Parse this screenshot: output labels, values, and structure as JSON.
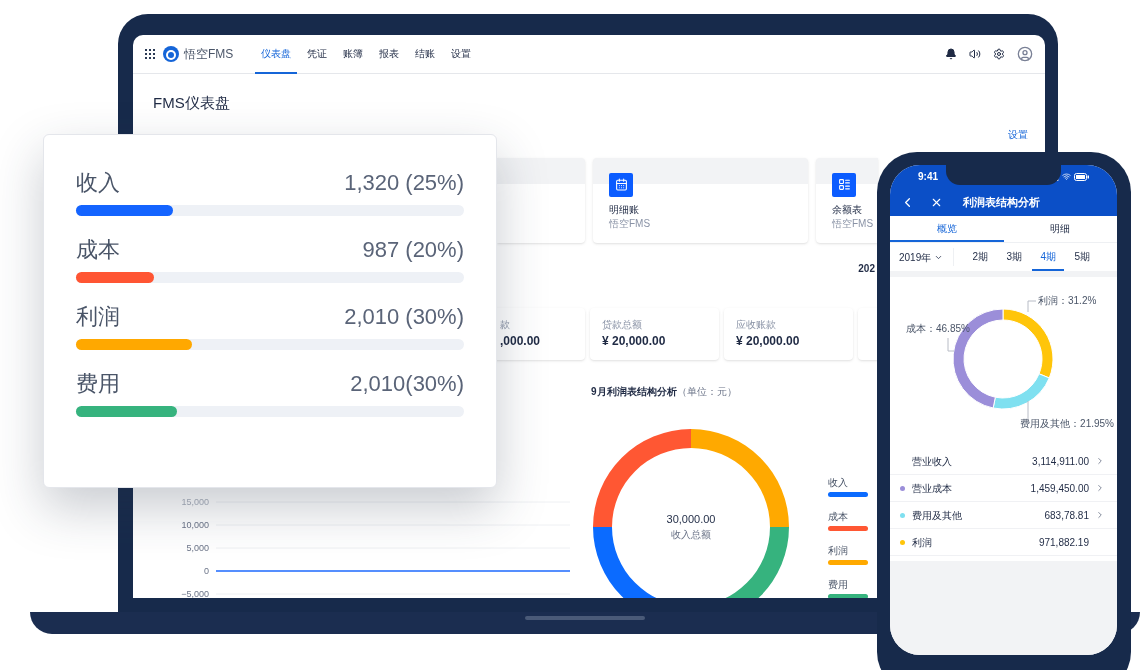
{
  "laptop": {
    "nav": {
      "brand": "悟空FMS",
      "tabs": [
        {
          "label": "仪表盘",
          "selected": true
        },
        {
          "label": "凭证",
          "selected": false
        },
        {
          "label": "账簿",
          "selected": false
        },
        {
          "label": "报表",
          "selected": false
        },
        {
          "label": "结账",
          "selected": false
        },
        {
          "label": "设置",
          "selected": false
        }
      ]
    },
    "page_title": "FMS仪表盘",
    "settings_link": "设置",
    "shortcuts": [
      {
        "title": "明细账",
        "subtitle": "悟空FMS",
        "kind": "calendar"
      },
      {
        "title": "余额表",
        "subtitle": "悟空FMS",
        "kind": "list"
      }
    ],
    "date_text": "202",
    "stats": [
      {
        "label": "款",
        "value": ",000.00"
      },
      {
        "label": "贷款总额",
        "value": "¥ 20,000.00"
      },
      {
        "label": "应收账款",
        "value": "¥ 20,000.00"
      }
    ],
    "line_chart": {
      "chart_data": {
        "type": "line",
        "ylim": [
          -5000,
          15000
        ],
        "yticks": [
          {
            "value": -5000,
            "label": "−5,000"
          },
          0,
          {
            "value": 5000,
            "label": "5,000"
          },
          {
            "value": 10000,
            "label": "10,000"
          },
          {
            "value": 15000,
            "label": "15,000"
          }
        ],
        "series": [
          {
            "color": "#1f6bff",
            "values": [
              0,
              0,
              0,
              0,
              0,
              0,
              0,
              0,
              0,
              0,
              0,
              0
            ]
          }
        ]
      }
    },
    "donut": {
      "title": "9月利润表结构分析",
      "unit": "（单位：元）",
      "total": "30,000.00",
      "total_label": "收入总额",
      "legend": [
        {
          "label": "收入",
          "color": "#0b6bff"
        },
        {
          "label": "成本",
          "color": "#ff5733"
        },
        {
          "label": "利润",
          "color": "#ffa900"
        },
        {
          "label": "费用",
          "color": "#36b37e"
        }
      ]
    }
  },
  "summary_card": {
    "rows": [
      {
        "label": "收入",
        "value": "1,320 (25%)",
        "level": 0.25,
        "color": "#1464ff"
      },
      {
        "label": "成本",
        "value": "987 (20%)",
        "level": 0.2,
        "color": "#ff5533"
      },
      {
        "label": "利润",
        "value": "2,010 (30%)",
        "level": 0.3,
        "color": "#ffa800"
      },
      {
        "label": "费用",
        "value": "2,010(30%)",
        "level": 0.26,
        "color": "#36b37e"
      }
    ]
  },
  "phone": {
    "time": "9:41",
    "title": "利润表结构分析",
    "tabs": [
      {
        "label": "概览",
        "selected": true
      },
      {
        "label": "明细",
        "selected": false
      }
    ],
    "year": "2019年",
    "periods": [
      {
        "label": "2期",
        "selected": false
      },
      {
        "label": "3期",
        "selected": false
      },
      {
        "label": "4期",
        "selected": true
      },
      {
        "label": "5期",
        "selected": false
      }
    ],
    "chart": {
      "chart_data": {
        "type": "donut",
        "values": [
          31.2,
          21.95,
          46.85
        ],
        "colors": [
          "#ffc50a",
          "#7fe0f0",
          "#9b8ed9"
        ],
        "value_labels": [
          "利润：31.2%",
          "费用及其他：21.95%",
          "成本：46.85%"
        ]
      }
    },
    "rows": [
      {
        "label": "营业收入",
        "value": "3,114,911.00",
        "chevron": true
      },
      {
        "label": "营业成本",
        "value": "1,459,450.00",
        "chevron": true,
        "color": "#9b8ed9"
      },
      {
        "label": "费用及其他",
        "value": "683,78.81",
        "chevron": true,
        "color": "#7fe0f0"
      },
      {
        "label": "利润",
        "value": "971,882.19",
        "chevron": false,
        "color": "#ffc50a"
      }
    ]
  }
}
